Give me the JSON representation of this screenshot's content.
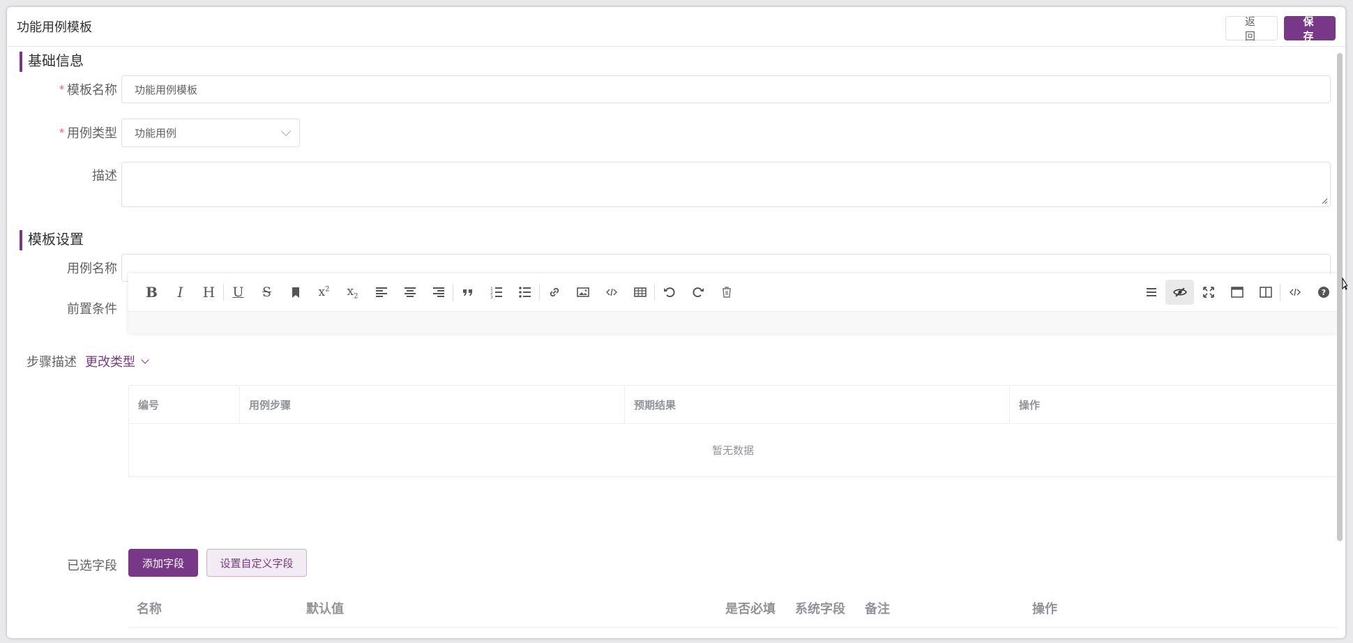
{
  "header": {
    "title": "功能用例模板",
    "back_label": "返 回",
    "save_label": "保 存"
  },
  "sections": {
    "basic_info": "基础信息",
    "template_settings": "模板设置"
  },
  "form": {
    "template_name_label": "模板名称",
    "template_name_value": "功能用例模板",
    "case_type_label": "用例类型",
    "case_type_value": "功能用例",
    "description_label": "描述",
    "description_value": "",
    "case_name_label": "用例名称",
    "case_name_value": "",
    "precondition_label": "前置条件",
    "required_mark": "*"
  },
  "editor": {
    "toolbar_left": [
      "bold-icon",
      "italic-icon",
      "header-icon",
      "underline-icon",
      "strikethrough-icon",
      "bookmark-icon",
      "superscript-icon",
      "subscript-icon",
      "align-left-icon",
      "align-center-icon",
      "align-right-icon",
      "quote-icon",
      "ordered-list-icon",
      "unordered-list-icon",
      "link-icon",
      "image-icon",
      "code-icon",
      "table-icon",
      "undo-icon",
      "redo-icon",
      "trash-icon"
    ],
    "toolbar_right": [
      "menu-icon",
      "preview-toggle-icon",
      "fullscreen-icon",
      "window-icon",
      "split-view-icon",
      "html-code-icon",
      "help-icon"
    ]
  },
  "steps": {
    "label": "步骤描述",
    "change_type": "更改类型",
    "columns": [
      "编号",
      "用例步骤",
      "预期结果",
      "操作"
    ],
    "empty_text": "暂无数据"
  },
  "selected_fields": {
    "label": "已选字段",
    "add_button": "添加字段",
    "custom_button": "设置自定义字段",
    "columns": [
      "名称",
      "默认值",
      "是否必填",
      "系统字段",
      "备注",
      "操作"
    ]
  },
  "colors": {
    "primary": "#783887",
    "required": "#f56c6c",
    "border": "#dcdfe6"
  }
}
